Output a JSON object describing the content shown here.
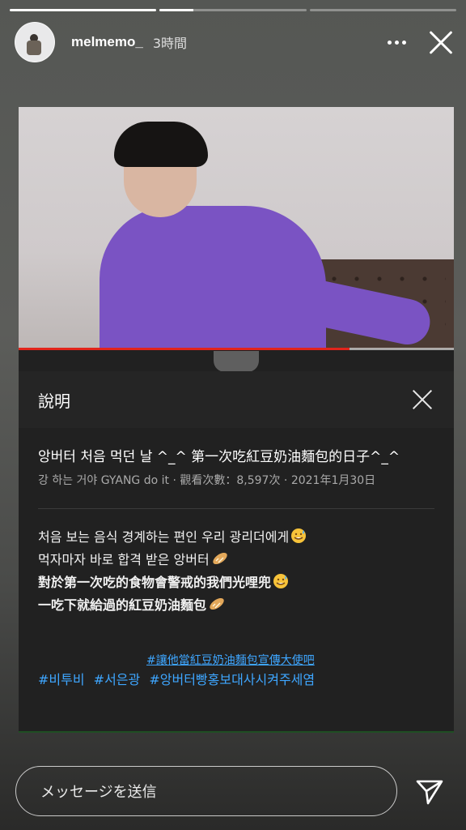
{
  "story": {
    "progress": [
      1.0,
      0.23,
      0.0
    ],
    "user": {
      "username": "melmemo_",
      "time_ago": "3時間"
    }
  },
  "video": {
    "playback_progress": 0.76,
    "colors": {
      "progress": "#e2241b",
      "shirt": "#7a53c3"
    }
  },
  "panel": {
    "title": "說明",
    "video_title": "앙버터 처음 먹던 날 ^_^  第一次吃紅豆奶油麵包的日子^_^",
    "channel": "강 하는 거야 GYANG do it",
    "views": "觀看次數：8,597次",
    "date": "2021年1月30日",
    "description": {
      "line1": "처음 보는 음식 경계하는 편인 우리 광리더에게",
      "line2": "먹자마자 바로 합격 받은 앙버터",
      "line3": "對於第一次吃的食物會警戒的我們光哩兜",
      "line4": "一吃下就給過的紅豆奶油麵包"
    },
    "tag_link": "#讓他當紅豆奶油麵包宣傳大使吧",
    "tags": [
      "#비투비",
      "#서은광",
      "#앙버터빵홍보대사시켜주세염"
    ],
    "link_color": "#3ea6ff"
  },
  "composer": {
    "placeholder": "メッセージを送信"
  }
}
